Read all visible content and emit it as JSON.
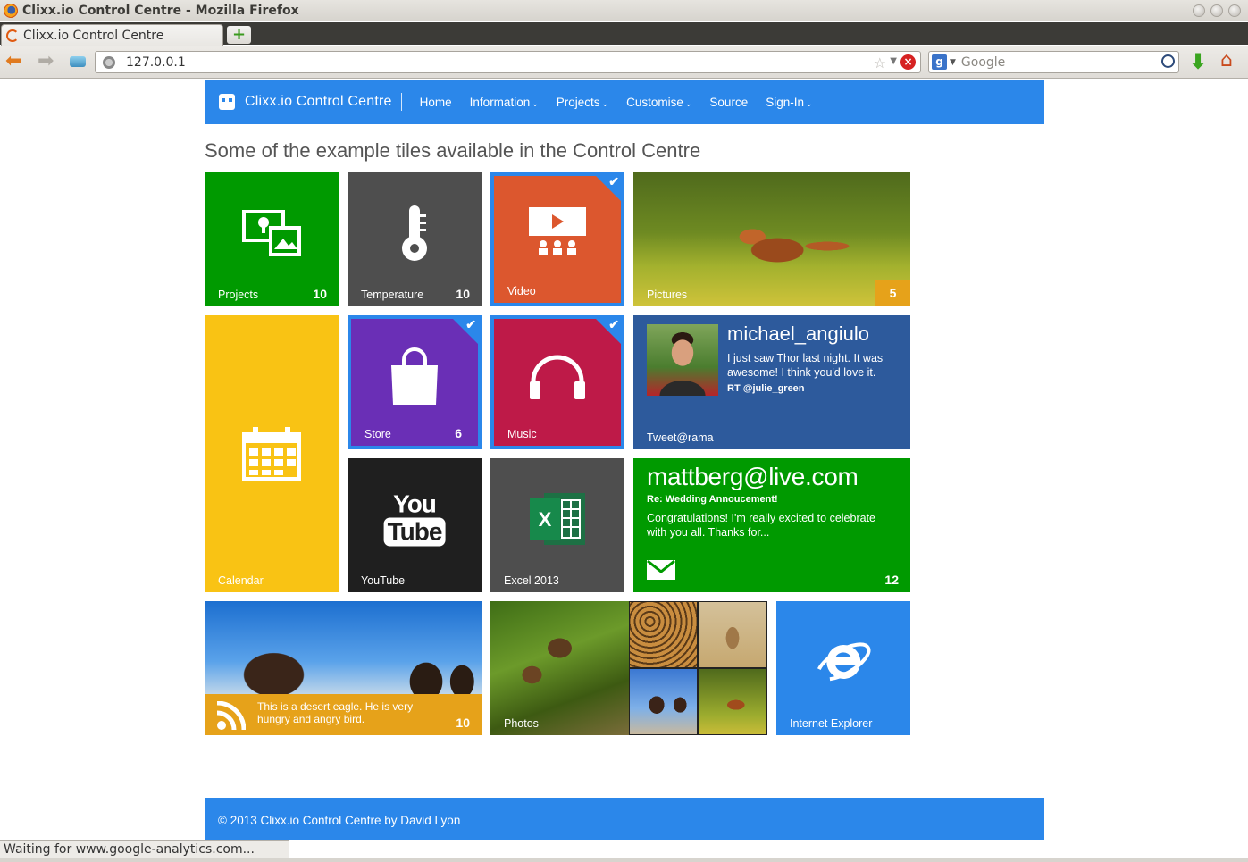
{
  "window": {
    "title": "Clixx.io Control Centre - Mozilla Firefox"
  },
  "browser": {
    "tab_label": "Clixx.io Control Centre",
    "new_tab_symbol": "+",
    "url": "127.0.0.1",
    "search_placeholder": "Google",
    "status_text": "Waiting for www.google-analytics.com..."
  },
  "site": {
    "brand": "Clixx.io Control Centre",
    "nav": [
      {
        "label": "Home",
        "dropdown": false
      },
      {
        "label": "Information",
        "dropdown": true
      },
      {
        "label": "Projects",
        "dropdown": true
      },
      {
        "label": "Customise",
        "dropdown": true
      },
      {
        "label": "Source",
        "dropdown": false
      },
      {
        "label": "Sign-In",
        "dropdown": true
      }
    ],
    "caret": "⌄",
    "heading": "Some of the example tiles available in the Control Centre",
    "footer": "© 2013 Clixx.io Control Centre by David Lyon"
  },
  "tiles": {
    "projects": {
      "label": "Projects",
      "count": "10",
      "color": "#009a00"
    },
    "temperature": {
      "label": "Temperature",
      "count": "10",
      "color": "#4e4e4e"
    },
    "video": {
      "label": "Video",
      "color": "#dc572e"
    },
    "pictures": {
      "label": "Pictures",
      "count": "5",
      "badge_color": "#e6a21a"
    },
    "calendar": {
      "label": "Calendar",
      "color": "#f9c314"
    },
    "store": {
      "label": "Store",
      "count": "6",
      "color": "#6a2fb6"
    },
    "music": {
      "label": "Music",
      "color": "#be1a48"
    },
    "tweet": {
      "username": "michael_angiulo",
      "text": "I just saw Thor last night. It was awesome! I think you'd love it.",
      "rt": "RT @julie_green",
      "label": "Tweet@rama",
      "color": "#2d5a9c"
    },
    "youtube": {
      "label": "YouTube",
      "logo_top": "You",
      "logo_bottom": "Tube",
      "color": "#1f1f1f"
    },
    "excel": {
      "label": "Excel 2013",
      "color": "#4e4e4e"
    },
    "mail": {
      "address": "mattberg@live.com",
      "subject": "Re: Wedding Annoucement!",
      "body": "Congratulations! I'm really excited to celebrate with you all. Thanks for...",
      "count": "12",
      "color": "#009a00"
    },
    "rss": {
      "text": "This is a desert eagle. He is very hungry and angry bird.",
      "count": "10"
    },
    "photos": {
      "label": "Photos"
    },
    "ie": {
      "label": "Internet Explorer",
      "color": "#2b87ea"
    }
  }
}
